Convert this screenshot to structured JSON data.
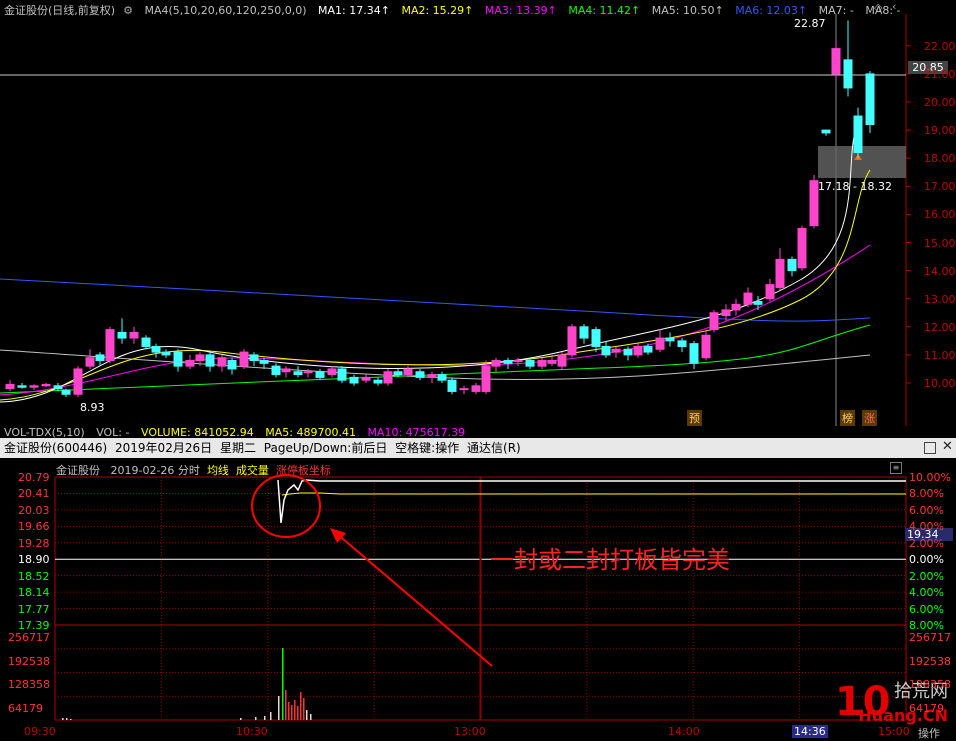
{
  "upper": {
    "legend": [
      {
        "text": "金证股份(日线,前复权)",
        "color": "#c0c0c0"
      },
      {
        "text": "MA4(5,10,20,60,120,250,0,0)",
        "color": "#c0c0c0"
      },
      {
        "text": "MA1: 17.34↑",
        "color": "#ffffff"
      },
      {
        "text": "MA2: 15.29↑",
        "color": "#ffff00"
      },
      {
        "text": "MA3: 13.39↑",
        "color": "#ff00ff"
      },
      {
        "text": "MA4: 11.42↑",
        "color": "#00ff00"
      },
      {
        "text": "MA5: 10.50↑",
        "color": "#c0c0c0"
      },
      {
        "text": "MA6: 12.03↑",
        "color": "#3355ff"
      },
      {
        "text": "MA7: -",
        "color": "#c0c0c0"
      },
      {
        "text": "MA8: -",
        "color": "#c0c0c0"
      }
    ],
    "price_ticks": [
      "22.00",
      "21.00",
      "20.00",
      "19.00",
      "18.00",
      "17.00",
      "16.00",
      "15.00",
      "14.00",
      "13.00",
      "12.00",
      "11.00",
      "10.00"
    ],
    "current_price": "20.85",
    "high_label": "22.87",
    "low_label": "8.93",
    "range_label": "17.18 - 18.32",
    "markers": [
      "预",
      "榜",
      "涨"
    ]
  },
  "volume_legend": [
    {
      "text": "VOL-TDX(5,10)",
      "color": "#c0c0c0"
    },
    {
      "text": "VOL: -",
      "color": "#c0c0c0"
    },
    {
      "text": "VOLUME: 841052.94",
      "color": "#ffff00"
    },
    {
      "text": "MA5: 489700.41",
      "color": "#ffff00"
    },
    {
      "text": "MA10: 475617.39",
      "color": "#ff00ff"
    }
  ],
  "divider": {
    "title": "金证股份(600446)",
    "date": "2019年02月26日",
    "weekday": "星期二",
    "hint": "PageUp/Down:前后日",
    "hint2": "空格键:操作",
    "app": "通达信(R)"
  },
  "intraday": {
    "name": "金证股份",
    "header_date": "2019-02-26 分时",
    "avg_label": "均线",
    "vol_label": "成交量",
    "limit_label": "涨停板坐标",
    "left_prices": [
      "20.79",
      "20.41",
      "20.03",
      "19.66",
      "19.28",
      "18.90",
      "18.52",
      "18.14",
      "17.77",
      "17.39"
    ],
    "left_vols": [
      "256717",
      "192538",
      "128358",
      "64179"
    ],
    "right_pcts": [
      "10.00%",
      "8.00%",
      "6.00%",
      "4.00%",
      "2.00%",
      "0.00%",
      "2.00%",
      "4.00%",
      "6.00%",
      "8.00%"
    ],
    "right_vols": [
      "256717",
      "192538",
      "128358",
      "64179"
    ],
    "current_value": "19.34",
    "time_labels": [
      "09:30",
      "10:30",
      "13:00",
      "14:00",
      "15:00"
    ],
    "time_cursor": "14:36",
    "annotation": "一封或二封打板皆完美",
    "op_label": "操作"
  },
  "watermark": {
    "num": "10",
    "cn": "拾荒网",
    "en": "Huang.CN"
  },
  "colors": {
    "up": "#ff44cc",
    "down": "#44ffff",
    "grid": "#8b0000",
    "axis": "#b00000"
  }
}
